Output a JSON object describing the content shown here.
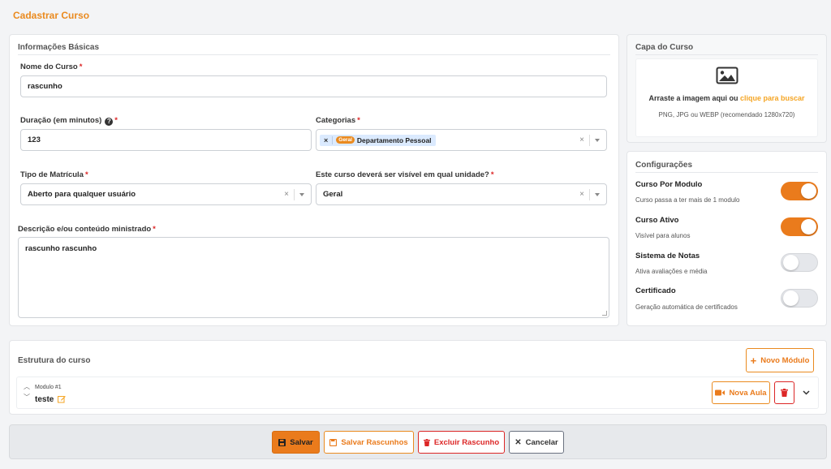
{
  "page": {
    "title": "Cadastrar Curso"
  },
  "basic": {
    "section_title": "Informações Básicas",
    "name_label": "Nome do Curso",
    "name_value": "rascunho",
    "duration_label": "Duração (em minutos)",
    "duration_value": "123",
    "categories_label": "Categorias",
    "category_chip": {
      "tag": "Geral",
      "label": "Departamento Pessoal",
      "remove": "×"
    },
    "enrollment_label": "Tipo de Matrícula",
    "enrollment_value": "Aberto para qualquer usuário",
    "unit_label": "Este curso deverá ser visível em qual unidade?",
    "unit_value": "Geral",
    "description_label": "Descrição e/ou conteúdo ministrado",
    "description_value": "rascunho rascunho",
    "required_mark": "*",
    "clear_mark": "×"
  },
  "cover": {
    "section_title": "Capa do Curso",
    "drop_text": "Arraste a imagem aqui ou ",
    "drop_link": "clique para buscar",
    "hint": "PNG, JPG ou WEBP (recomendado 1280x720)"
  },
  "config": {
    "section_title": "Configurações",
    "items": [
      {
        "title": "Curso Por Modulo",
        "desc": "Curso passa a ter mais de 1 modulo",
        "on": true
      },
      {
        "title": "Curso Ativo",
        "desc": "Visível para alunos",
        "on": true
      },
      {
        "title": "Sistema de Notas",
        "desc": "Ativa avaliações e média",
        "on": false
      },
      {
        "title": "Certificado",
        "desc": "Geração automática de certificados",
        "on": false
      }
    ]
  },
  "structure": {
    "section_title": "Estrutura do curso",
    "new_module_label": "Novo Módulo",
    "module": {
      "number": "Modulo #1",
      "name": "teste"
    },
    "new_lesson_label": "Nova Aula"
  },
  "footer": {
    "save_label": "Salvar",
    "save_draft_label": "Salvar Rascunhos",
    "delete_draft_label": "Excluir Rascunho",
    "cancel_label": "Cancelar"
  },
  "colors": {
    "accent": "#ea7b1c",
    "danger": "#dc2626",
    "link": "#f5a524"
  }
}
